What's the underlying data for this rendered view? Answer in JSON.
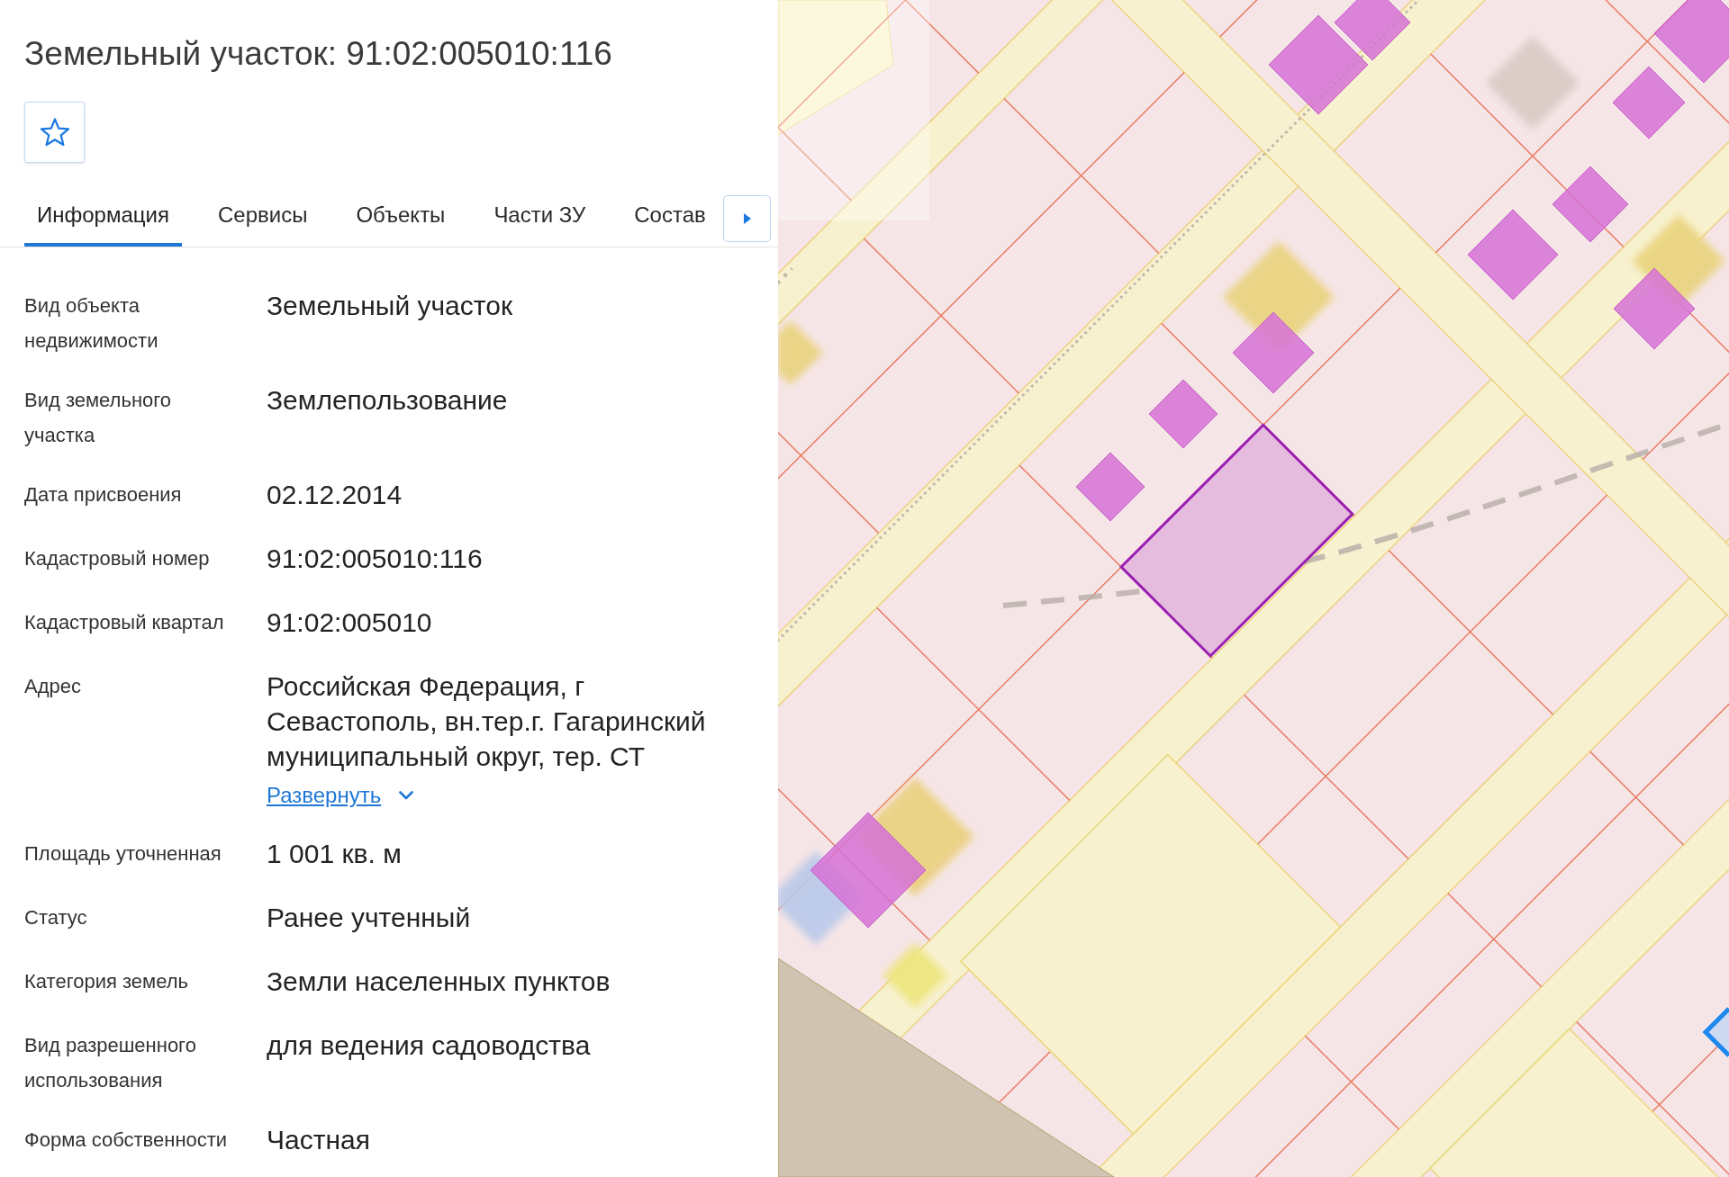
{
  "panel": {
    "title": "Земельный участок: 91:02:005010:116",
    "starred": false,
    "tabs": [
      {
        "label": "Информация",
        "selected": true
      },
      {
        "label": "Сервисы",
        "selected": false
      },
      {
        "label": "Объекты",
        "selected": false
      },
      {
        "label": "Части ЗУ",
        "selected": false
      },
      {
        "label": "Состав",
        "selected": false
      }
    ],
    "fields": [
      {
        "label": "Вид объекта недвижимости",
        "value": "Земельный участок"
      },
      {
        "label": "Вид земельного участка",
        "value": "Землепользование"
      },
      {
        "label": "Дата присвоения",
        "value": "02.12.2014"
      },
      {
        "label": "Кадастровый номер",
        "value": "91:02:005010:116"
      },
      {
        "label": "Кадастровый квартал",
        "value": "91:02:005010"
      },
      {
        "label": "Адрес",
        "value": "Российская Федерация, г Севастополь, вн.тер.г. Гагаринский муниципальный округ, тер. СТ",
        "expand_link": "Развернуть"
      },
      {
        "label": "Площадь уточненная",
        "value": "1 001 кв. м"
      },
      {
        "label": "Статус",
        "value": "Ранее учтенный"
      },
      {
        "label": "Категория земель",
        "value": "Земли населенных пунктов"
      },
      {
        "label": "Вид разрешенного использования",
        "value": "для ведения садоводства"
      },
      {
        "label": "Форма собственности",
        "value": "Частная"
      }
    ]
  },
  "map": {
    "kind": "cadastral"
  }
}
